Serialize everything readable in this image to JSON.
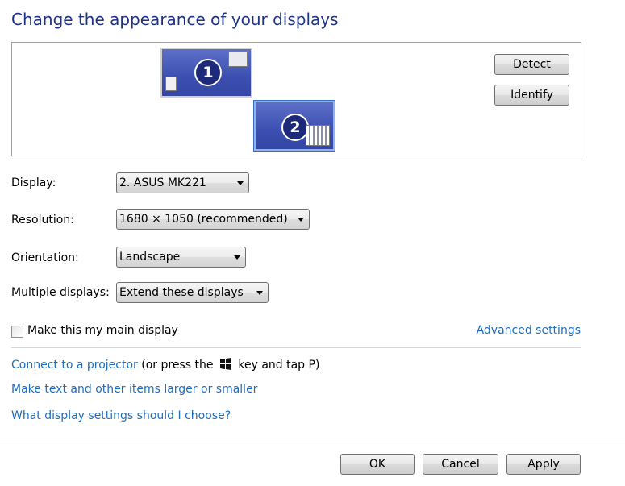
{
  "title": "Change the appearance of your displays",
  "preview": {
    "monitor_1": "1",
    "monitor_2": "2",
    "detect_label": "Detect",
    "identify_label": "Identify"
  },
  "settings": {
    "display": {
      "label": "Display:",
      "value": "2. ASUS MK221"
    },
    "resolution": {
      "label": "Resolution:",
      "value": "1680 × 1050 (recommended)"
    },
    "orientation": {
      "label": "Orientation:",
      "value": "Landscape"
    },
    "multiple": {
      "label": "Multiple displays:",
      "value": "Extend these displays"
    }
  },
  "main_display": {
    "label": "Make this my main display",
    "checked": false
  },
  "advanced_link": "Advanced settings",
  "links": {
    "projector": "Connect to a projector",
    "projector_hint_pre": "(or press the",
    "projector_hint_post": "key and tap P)",
    "text_size": "Make text and other items larger or smaller",
    "help": "What display settings should I choose?"
  },
  "footer": {
    "ok": "OK",
    "cancel": "Cancel",
    "apply": "Apply"
  },
  "colors": {
    "link": "#1f6dbf",
    "title": "#1e3287",
    "monitor": "#3b4fb0"
  },
  "icons": [
    "windows-logo-icon",
    "dropdown-arrow-icon",
    "checkbox-icon"
  ]
}
